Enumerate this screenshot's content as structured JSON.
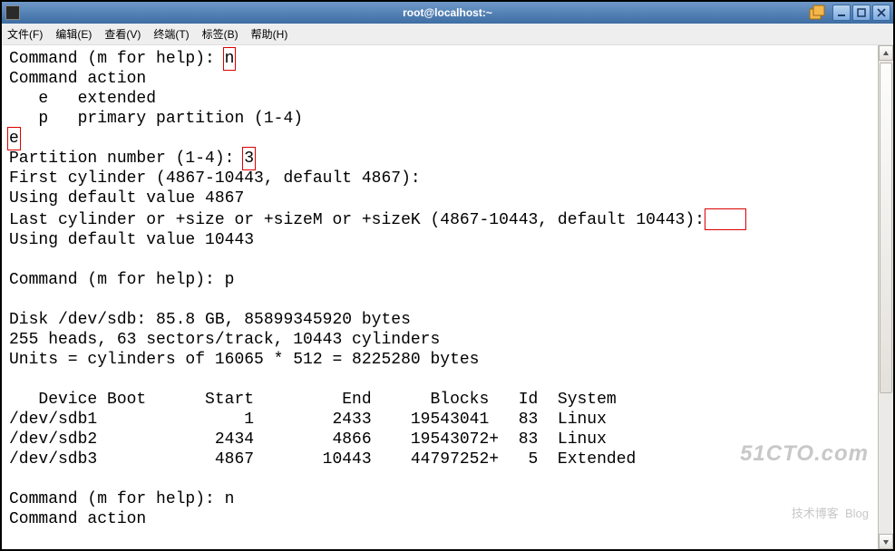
{
  "window": {
    "title": "root@localhost:~"
  },
  "menu": {
    "file": "文件(F)",
    "edit": "编辑(E)",
    "view": "查看(V)",
    "terminal": "终端(T)",
    "tabs": "标签(B)",
    "help": "帮助(H)"
  },
  "term": {
    "l01a": "Command (m for help): ",
    "l01b": "n",
    "l02": "Command action",
    "l03": "   e   extended",
    "l04": "   p   primary partition (1-4)",
    "l05": "e",
    "l06a": "Partition number (1-4): ",
    "l06b": "3",
    "l07": "First cylinder (4867-10443, default 4867):",
    "l08": "Using default value 4867",
    "l09": "Last cylinder or +size or +sizeM or +sizeK (4867-10443, default 10443):",
    "l10": "Using default value 10443",
    "l11": "",
    "l12": "Command (m for help): p",
    "l13": "",
    "l14": "Disk /dev/sdb: 85.8 GB, 85899345920 bytes",
    "l15": "255 heads, 63 sectors/track, 10443 cylinders",
    "l16": "Units = cylinders of 16065 * 512 = 8225280 bytes",
    "l17": "",
    "l18": "   Device Boot      Start         End      Blocks   Id  System",
    "l19": "/dev/sdb1               1        2433    19543041   83  Linux",
    "l20": "/dev/sdb2            2434        4866    19543072+  83  Linux",
    "l21": "/dev/sdb3            4867       10443    44797252+   5  Extended",
    "l22": "",
    "l23": "Command (m for help): n",
    "l24": "Command action"
  },
  "watermark": {
    "big": "51CTO.com",
    "small": "技术博客  Blog"
  }
}
